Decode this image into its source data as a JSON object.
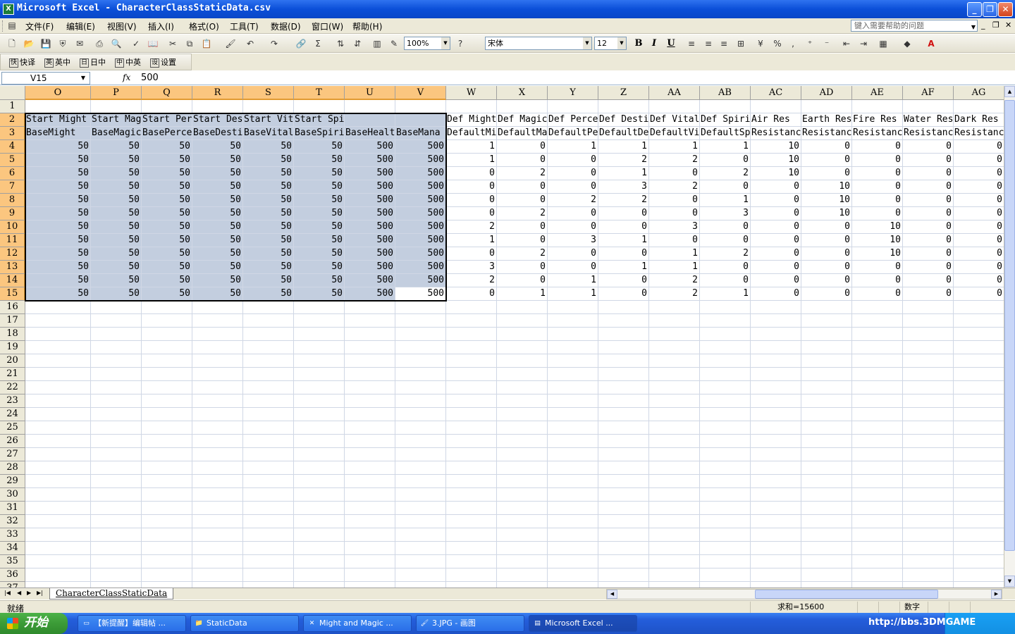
{
  "window": {
    "title": "Microsoft Excel - CharacterClassStaticData.csv"
  },
  "menu": [
    "文件(F)",
    "编辑(E)",
    "视图(V)",
    "插入(I)",
    "格式(O)",
    "工具(T)",
    "数据(D)",
    "窗口(W)",
    "帮助(H)"
  ],
  "help_placeholder": "键入需要帮助的问题",
  "toolbar": {
    "zoom": "100%",
    "font": "宋体",
    "font_size": "12"
  },
  "toolbar2": [
    "快译",
    "英中",
    "日中",
    "中英",
    "设置"
  ],
  "formula": {
    "namebox": "V15",
    "fx": "fx",
    "value": "500"
  },
  "columns": [
    "O",
    "P",
    "Q",
    "R",
    "S",
    "T",
    "U",
    "V",
    "W",
    "X",
    "Y",
    "Z",
    "AA",
    "AB",
    "AC",
    "AD",
    "AE",
    "AF",
    "AG"
  ],
  "row_numbers": [
    "1",
    "2",
    "3",
    "4",
    "5",
    "6",
    "7",
    "8",
    "9",
    "10",
    "11",
    "12",
    "13",
    "14",
    "15",
    "16",
    "17",
    "18",
    "19",
    "20",
    "21",
    "22",
    "23",
    "24",
    "25",
    "26",
    "27",
    "28",
    "29",
    "30",
    "31",
    "32",
    "33",
    "34",
    "35",
    "36",
    "37"
  ],
  "header_row2": [
    "Start Might",
    "Start Magic",
    "Start Perception",
    "Start Destiny",
    "Start Vitality",
    "Start Spirit",
    "",
    "",
    "Def Might",
    "Def Magic",
    "Def Perception",
    "Def Destiny",
    "Def Vitality",
    "Def Spirit",
    "Air Res",
    "Earth Res",
    "Fire Res",
    "Water Res",
    "Dark Res"
  ],
  "header_row3": [
    "BaseMight",
    "BaseMagic",
    "BasePerception",
    "BaseDestiny",
    "BaseVitality",
    "BaseSpirit",
    "BaseHealth",
    "BaseMana",
    "DefaultMight",
    "DefaultMagic",
    "DefaultPerception",
    "DefaultDestiny",
    "DefaultVitality",
    "DefaultSpirit",
    "Resistance",
    "Resistance",
    "Resistance",
    "Resistance",
    "Resistance"
  ],
  "data_rows": [
    [
      "50",
      "50",
      "50",
      "50",
      "50",
      "50",
      "500",
      "500",
      "1",
      "0",
      "1",
      "1",
      "1",
      "1",
      "10",
      "0",
      "0",
      "0",
      "0"
    ],
    [
      "50",
      "50",
      "50",
      "50",
      "50",
      "50",
      "500",
      "500",
      "1",
      "0",
      "0",
      "2",
      "2",
      "0",
      "10",
      "0",
      "0",
      "0",
      "0"
    ],
    [
      "50",
      "50",
      "50",
      "50",
      "50",
      "50",
      "500",
      "500",
      "0",
      "2",
      "0",
      "1",
      "0",
      "2",
      "10",
      "0",
      "0",
      "0",
      "0"
    ],
    [
      "50",
      "50",
      "50",
      "50",
      "50",
      "50",
      "500",
      "500",
      "0",
      "0",
      "0",
      "3",
      "2",
      "0",
      "0",
      "10",
      "0",
      "0",
      "0"
    ],
    [
      "50",
      "50",
      "50",
      "50",
      "50",
      "50",
      "500",
      "500",
      "0",
      "0",
      "2",
      "2",
      "0",
      "1",
      "0",
      "10",
      "0",
      "0",
      "0"
    ],
    [
      "50",
      "50",
      "50",
      "50",
      "50",
      "50",
      "500",
      "500",
      "0",
      "2",
      "0",
      "0",
      "0",
      "3",
      "0",
      "10",
      "0",
      "0",
      "0"
    ],
    [
      "50",
      "50",
      "50",
      "50",
      "50",
      "50",
      "500",
      "500",
      "2",
      "0",
      "0",
      "0",
      "3",
      "0",
      "0",
      "0",
      "10",
      "0",
      "0"
    ],
    [
      "50",
      "50",
      "50",
      "50",
      "50",
      "50",
      "500",
      "500",
      "1",
      "0",
      "3",
      "1",
      "0",
      "0",
      "0",
      "0",
      "10",
      "0",
      "0"
    ],
    [
      "50",
      "50",
      "50",
      "50",
      "50",
      "50",
      "500",
      "500",
      "0",
      "2",
      "0",
      "0",
      "1",
      "2",
      "0",
      "0",
      "10",
      "0",
      "0"
    ],
    [
      "50",
      "50",
      "50",
      "50",
      "50",
      "50",
      "500",
      "500",
      "3",
      "0",
      "0",
      "1",
      "1",
      "0",
      "0",
      "0",
      "0",
      "0",
      "0"
    ],
    [
      "50",
      "50",
      "50",
      "50",
      "50",
      "50",
      "500",
      "500",
      "2",
      "0",
      "1",
      "0",
      "2",
      "0",
      "0",
      "0",
      "0",
      "0",
      "0"
    ],
    [
      "50",
      "50",
      "50",
      "50",
      "50",
      "50",
      "500",
      "500",
      "0",
      "1",
      "1",
      "0",
      "2",
      "1",
      "0",
      "0",
      "0",
      "0",
      "0"
    ]
  ],
  "sheet_tab": "CharacterClassStaticData",
  "status": {
    "ready": "就绪",
    "sum": "求和=15600",
    "mode": "数字"
  },
  "taskbar": {
    "start": "开始",
    "tasks": [
      "【新提醒】编辑帖 ...",
      "StaticData",
      "Might and Magic ...",
      "3.JPG - 画图",
      "Microsoft Excel ..."
    ],
    "watermark": "http://bbs.3DMGAME"
  },
  "colors": {
    "selection": "#c3cedf",
    "header_selected": "#fbc67f",
    "title_blue": "#0b4fd8"
  }
}
